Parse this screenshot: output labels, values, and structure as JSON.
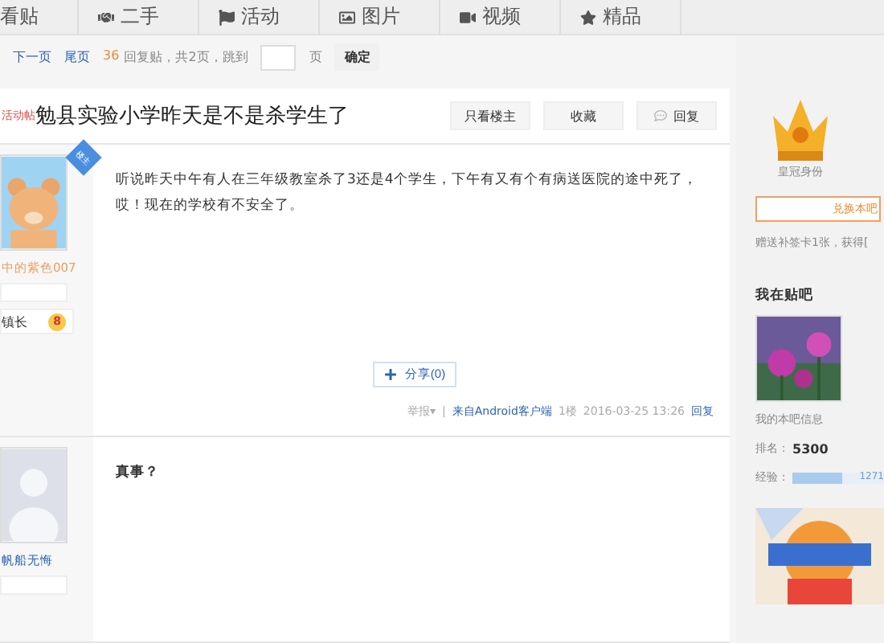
{
  "nav": {
    "tabs": [
      {
        "label": "看贴",
        "selected": false
      },
      {
        "label": "二手",
        "selected": false
      },
      {
        "label": "活动",
        "selected": false
      },
      {
        "label": "图片",
        "selected": false
      },
      {
        "label": "视频",
        "selected": false
      },
      {
        "label": "精品",
        "selected": false
      }
    ]
  },
  "pager": {
    "links": [
      "下一页",
      "尾页"
    ],
    "reply_count": "36",
    "summary": "回复贴，共2页，跳到",
    "page_unit": "页",
    "confirm": "确定"
  },
  "thread": {
    "tag": "活动帖",
    "title": "勉县实验小学昨天是不是杀学生了",
    "actions": [
      {
        "label": "只看楼主",
        "kind": "plain"
      },
      {
        "label": "收藏",
        "kind": "plain"
      },
      {
        "label": "回复",
        "kind": "reply"
      }
    ]
  },
  "posts": [
    {
      "author": "中的紫色007",
      "is_op": true,
      "op_badge": "楼主",
      "rank": "镇长",
      "level": "8",
      "lines": [
        "听说昨天中午有人在三年级教室杀了3还是4个学生，下午有又有个有病送医院的途中死了，",
        "哎！现在的学校有不安全了。"
      ],
      "share": "分享(0)",
      "footer": {
        "report": "举报▾",
        "separator": "|",
        "source": "来自Android客户端",
        "floor": "1楼",
        "time": "2016-03-25 13:26",
        "reply": "回复"
      }
    },
    {
      "author": "帆船无悔",
      "is_op": false,
      "lines": [
        "真事？"
      ]
    }
  ],
  "sidebar": {
    "crown_label": "皇冠身份",
    "redeem_button": "兑换本吧",
    "gift_note": "赠送补签卡1张，获得[",
    "my_bar_title": "我在贴吧",
    "my_info": "我的本吧信息",
    "rank_label": "排名：",
    "rank_value": "5300",
    "exp_label": "经验：",
    "exp_value": "1271",
    "exp": {
      "level": 0.55
    }
  }
}
